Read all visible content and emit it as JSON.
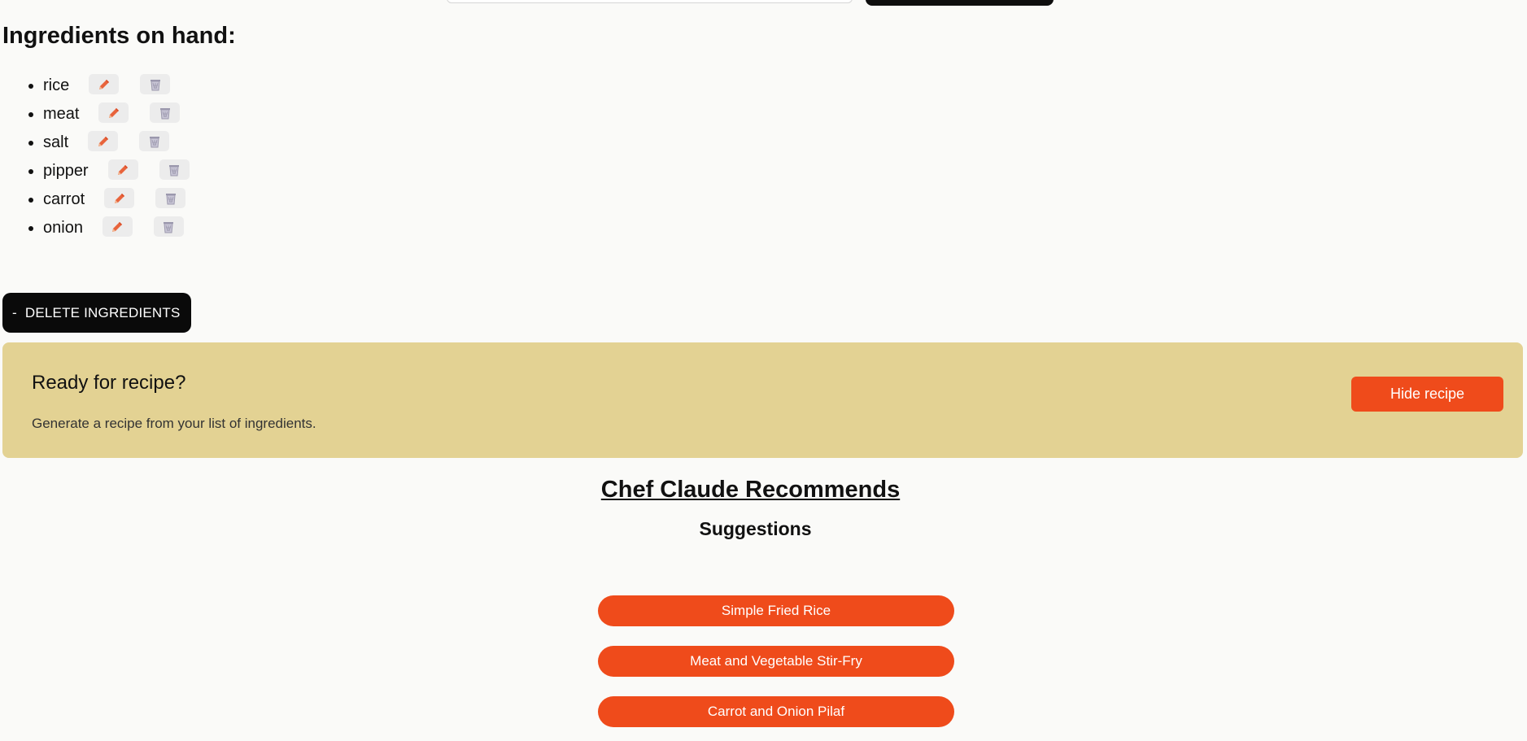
{
  "ingredients_title": "Ingredients on hand:",
  "ingredients": [
    {
      "name": "rice"
    },
    {
      "name": "meat"
    },
    {
      "name": "salt"
    },
    {
      "name": "pipper"
    },
    {
      "name": "carrot"
    },
    {
      "name": "onion"
    }
  ],
  "icons": {
    "edit": "pencil-icon",
    "delete": "trash-icon"
  },
  "delete_button": {
    "symbol": "-",
    "label": "DELETE INGREDIENTS"
  },
  "recipe_panel": {
    "title": "Ready for recipe?",
    "text": "Generate a recipe from your list of ingredients.",
    "button_label": "Hide recipe"
  },
  "recommendations": {
    "title": "Chef Claude Recommends",
    "subtitle": "Suggestions",
    "items": [
      "Simple Fried Rice",
      "Meat and Vegetable Stir-Fry",
      "Carrot and Onion Pilaf"
    ]
  },
  "colors": {
    "accent": "#ef4b1b",
    "panel": "#e3d293",
    "dark_button": "#0a0a0a",
    "background": "#fafaf8"
  }
}
